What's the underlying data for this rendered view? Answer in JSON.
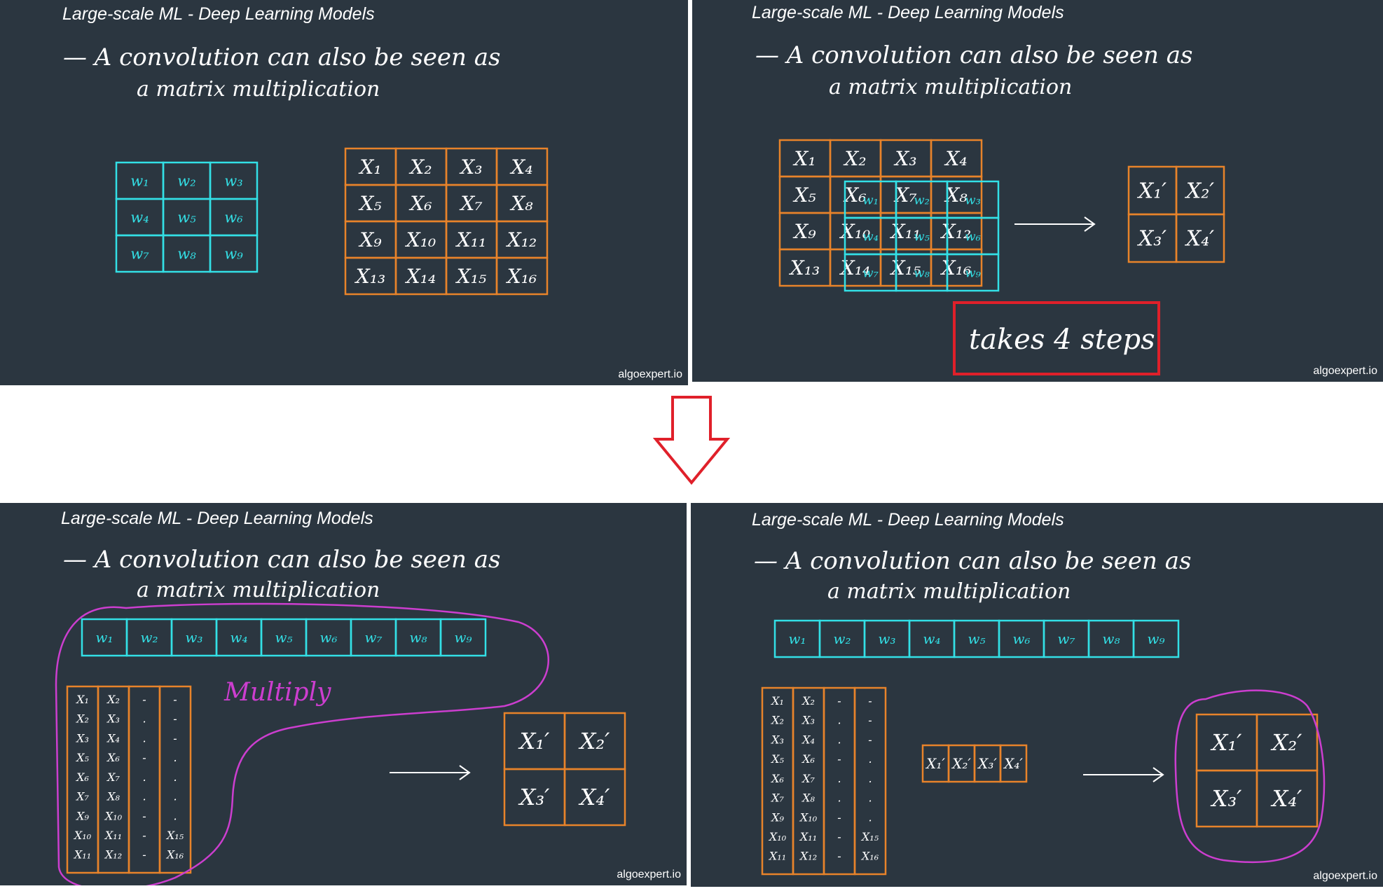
{
  "title": "Large-scale ML - Deep Learning Models",
  "line1": "— A convolution can also be seen as",
  "line2": "a matrix multiplication",
  "brand": "algoexpert.io",
  "kernel": [
    "w₁",
    "w₂",
    "w₃",
    "w₄",
    "w₅",
    "w₆",
    "w₇",
    "w₈",
    "w₉"
  ],
  "input": [
    "X₁",
    "X₂",
    "X₃",
    "X₄",
    "X₅",
    "X₆",
    "X₇",
    "X₈",
    "X₉",
    "X₁₀",
    "X₁₁",
    "X₁₂",
    "X₁₃",
    "X₁₄",
    "X₁₅",
    "X₁₆"
  ],
  "output": [
    "X₁′",
    "X₂′",
    "X₃′",
    "X₄′"
  ],
  "steps_label": "takes 4 steps",
  "multiply_label": "Multiply",
  "col1": [
    "X₁",
    "X₂",
    "X₃",
    "X₅",
    "X₆",
    "X₇",
    "X₉",
    "X₁₀",
    "X₁₁"
  ],
  "col2": [
    "X₂",
    "X₃",
    "X₄",
    "X₆",
    "X₇",
    "X₈",
    "X₁₀",
    "X₁₁",
    "X₁₂"
  ],
  "col4_tail": [
    "X₁₅",
    "X₁₆"
  ],
  "dash": "-",
  "dot": ".",
  "colors": {
    "kernel": "#33e0e6",
    "input": "#e8832a",
    "highlight": "#e0202a",
    "multiply": "#cc3ecf",
    "text": "#ffffff",
    "bg": "#2b3640"
  }
}
